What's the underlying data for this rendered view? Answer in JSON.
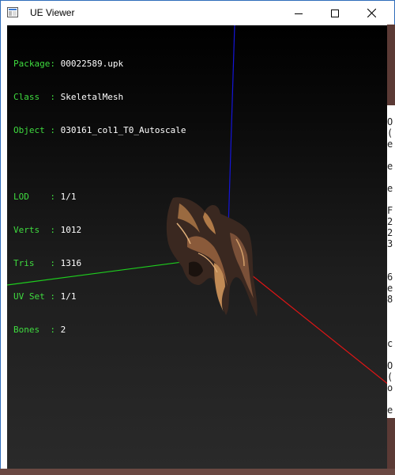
{
  "window": {
    "title": "UE Viewer"
  },
  "controls": {
    "minimize": "minimize",
    "maximize": "maximize",
    "close": "close"
  },
  "info": {
    "rows1": [
      {
        "key": "Package",
        "sep": ": ",
        "value": "00022589.upk"
      },
      {
        "key": "Class  ",
        "sep": ": ",
        "value": "SkeletalMesh"
      },
      {
        "key": "Object ",
        "sep": ": ",
        "value": "030161_col1_T0_Autoscale"
      }
    ],
    "rows2": [
      {
        "key": "LOD    ",
        "sep": ": ",
        "value": "1/1"
      },
      {
        "key": "Verts  ",
        "sep": ": ",
        "value": "1012"
      },
      {
        "key": "Tris   ",
        "sep": ": ",
        "value": "1316"
      },
      {
        "key": "UV Set ",
        "sep": ": ",
        "value": "1/1"
      },
      {
        "key": "Bones  ",
        "sep": ": ",
        "value": "2"
      }
    ]
  },
  "side_panel": [
    "",
    "O",
    "(",
    "e",
    "",
    "e",
    "",
    "e",
    "",
    "F",
    "2",
    "2",
    "3",
    "",
    "",
    "6",
    "e",
    "8",
    "",
    "",
    "",
    "c",
    "",
    "O",
    "(",
    "o",
    "",
    "e"
  ],
  "colors": {
    "x_axis": "#e01515",
    "y_axis": "#1ecf1e",
    "z_axis": "#1515d8",
    "label_key": "#3fdc3f"
  }
}
